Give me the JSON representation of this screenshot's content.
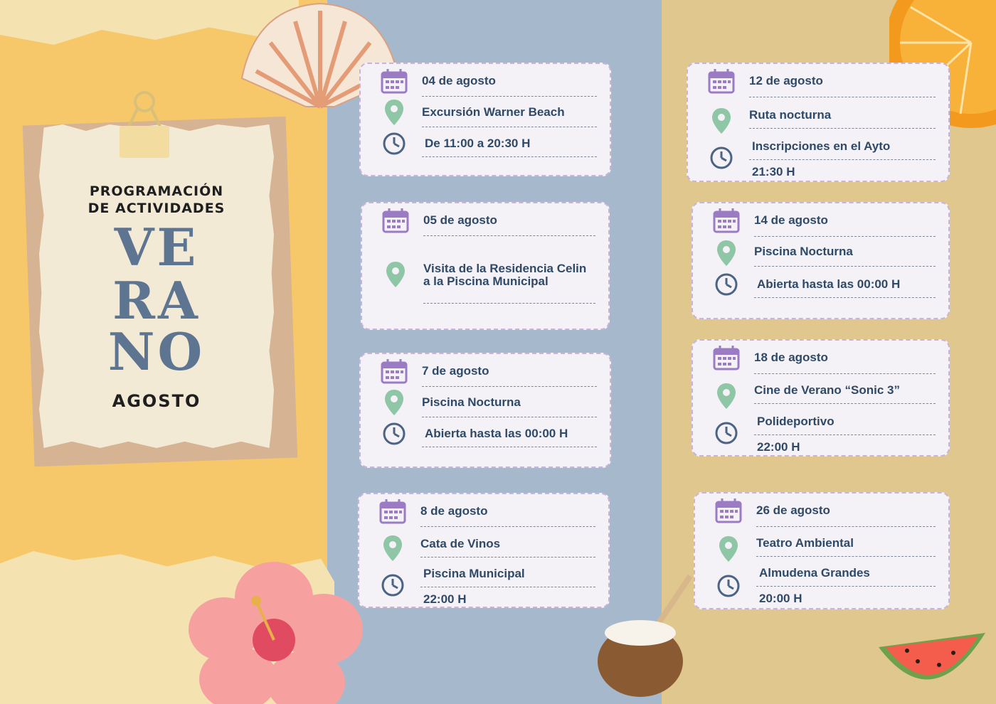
{
  "poster": {
    "line1": "PROGRAMACIÓN",
    "line2": "DE ACTIVIDADES",
    "word1": "VE",
    "word2": "RA",
    "word3": "NO",
    "month": "AGOSTO"
  },
  "colors": {
    "left_panel": "#f7c86a",
    "middle_panel": "#a6b9cc",
    "right_panel": "#dfc78e",
    "title_blue": "#5e7592",
    "card_text": "#2f4a66",
    "calendar_icon": "#9a7bc4",
    "pin_icon": "#8fc6a6",
    "clock_icon": "#4b6484"
  },
  "icons": [
    "calendar-icon",
    "location-pin-icon",
    "clock-icon"
  ],
  "events": [
    {
      "date": "04 de agosto",
      "place": "Excursión Warner Beach",
      "line3": "De 11:00 a 20:30 H",
      "line4": ""
    },
    {
      "date": "05 de agosto",
      "place": "Visita de la Residencia Celin",
      "place2": "a la Piscina Municipal",
      "line3": "",
      "line4": ""
    },
    {
      "date": "7 de agosto",
      "place": "Piscina Nocturna",
      "line3": "Abierta hasta las 00:00 H",
      "line4": ""
    },
    {
      "date": "8 de agosto",
      "place": "Cata de Vinos",
      "line3": "Piscina Municipal",
      "line4": "22:00 H"
    },
    {
      "date": "12 de agosto",
      "place": "Ruta nocturna",
      "line3": "Inscripciones en el Ayto",
      "line4": "21:30 H"
    },
    {
      "date": "14 de agosto",
      "place": "Piscina Nocturna",
      "line3": "Abierta hasta las 00:00 H",
      "line4": ""
    },
    {
      "date": "18 de agosto",
      "place": "Cine de Verano “Sonic 3”",
      "line3": "Polideportivo",
      "line4": "22:00 H"
    },
    {
      "date": "26 de agosto",
      "place": "Teatro Ambiental",
      "line3": "Almudena Grandes",
      "line4": "20:00 H"
    }
  ]
}
